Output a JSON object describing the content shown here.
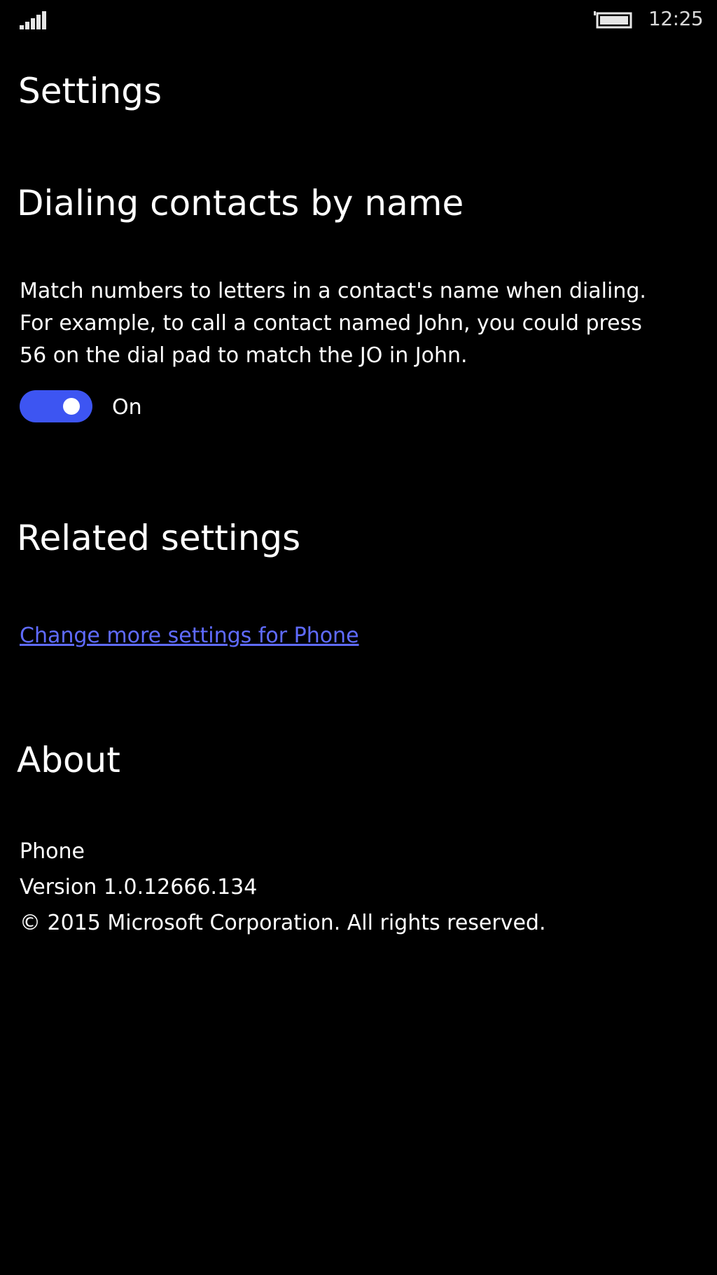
{
  "status_bar": {
    "time": "12:25",
    "signal_icon": "signal-strength-icon",
    "battery_icon": "battery-icon"
  },
  "page_title": "Settings",
  "dialing": {
    "header": "Dialing contacts by name",
    "description_lines": [
      "Match numbers to letters in a contact's name when dialing.",
      "For example, to call a contact named John, you could press",
      "56 on the dial pad to match the JO in John."
    ],
    "toggle_state": "On",
    "toggle_on": true
  },
  "related": {
    "header": "Related settings",
    "link": "Change more settings for Phone"
  },
  "about": {
    "header": "About",
    "app_name": "Phone",
    "version": "Version 1.0.12666.134",
    "copyright": "© 2015 Microsoft Corporation. All rights reserved."
  },
  "colors": {
    "background": "#000000",
    "accent": "#3d55f2",
    "link": "#5f6bff",
    "text": "#ffffff"
  }
}
